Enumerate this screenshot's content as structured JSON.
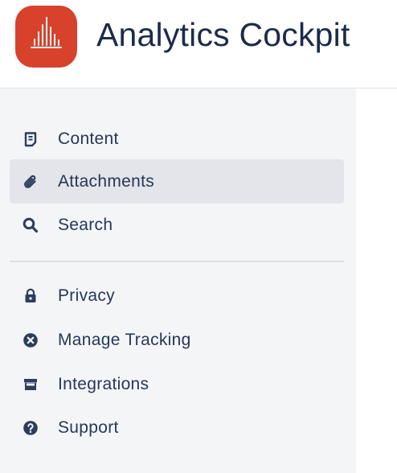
{
  "header": {
    "logo_icon": "bar-chart-logo-icon",
    "title": "Analytics Cockpit",
    "brand_color": "#d8412c"
  },
  "sidebar": {
    "active_item": "Attachments",
    "primary_items": [
      {
        "label": "Content",
        "icon": "document-icon"
      },
      {
        "label": "Attachments",
        "icon": "paperclip-icon"
      },
      {
        "label": "Search",
        "icon": "search-icon"
      }
    ],
    "secondary_items": [
      {
        "label": "Privacy",
        "icon": "lock-icon"
      },
      {
        "label": "Manage Tracking",
        "icon": "close-circle-icon"
      },
      {
        "label": "Integrations",
        "icon": "store-icon"
      },
      {
        "label": "Support",
        "icon": "help-icon"
      }
    ]
  }
}
